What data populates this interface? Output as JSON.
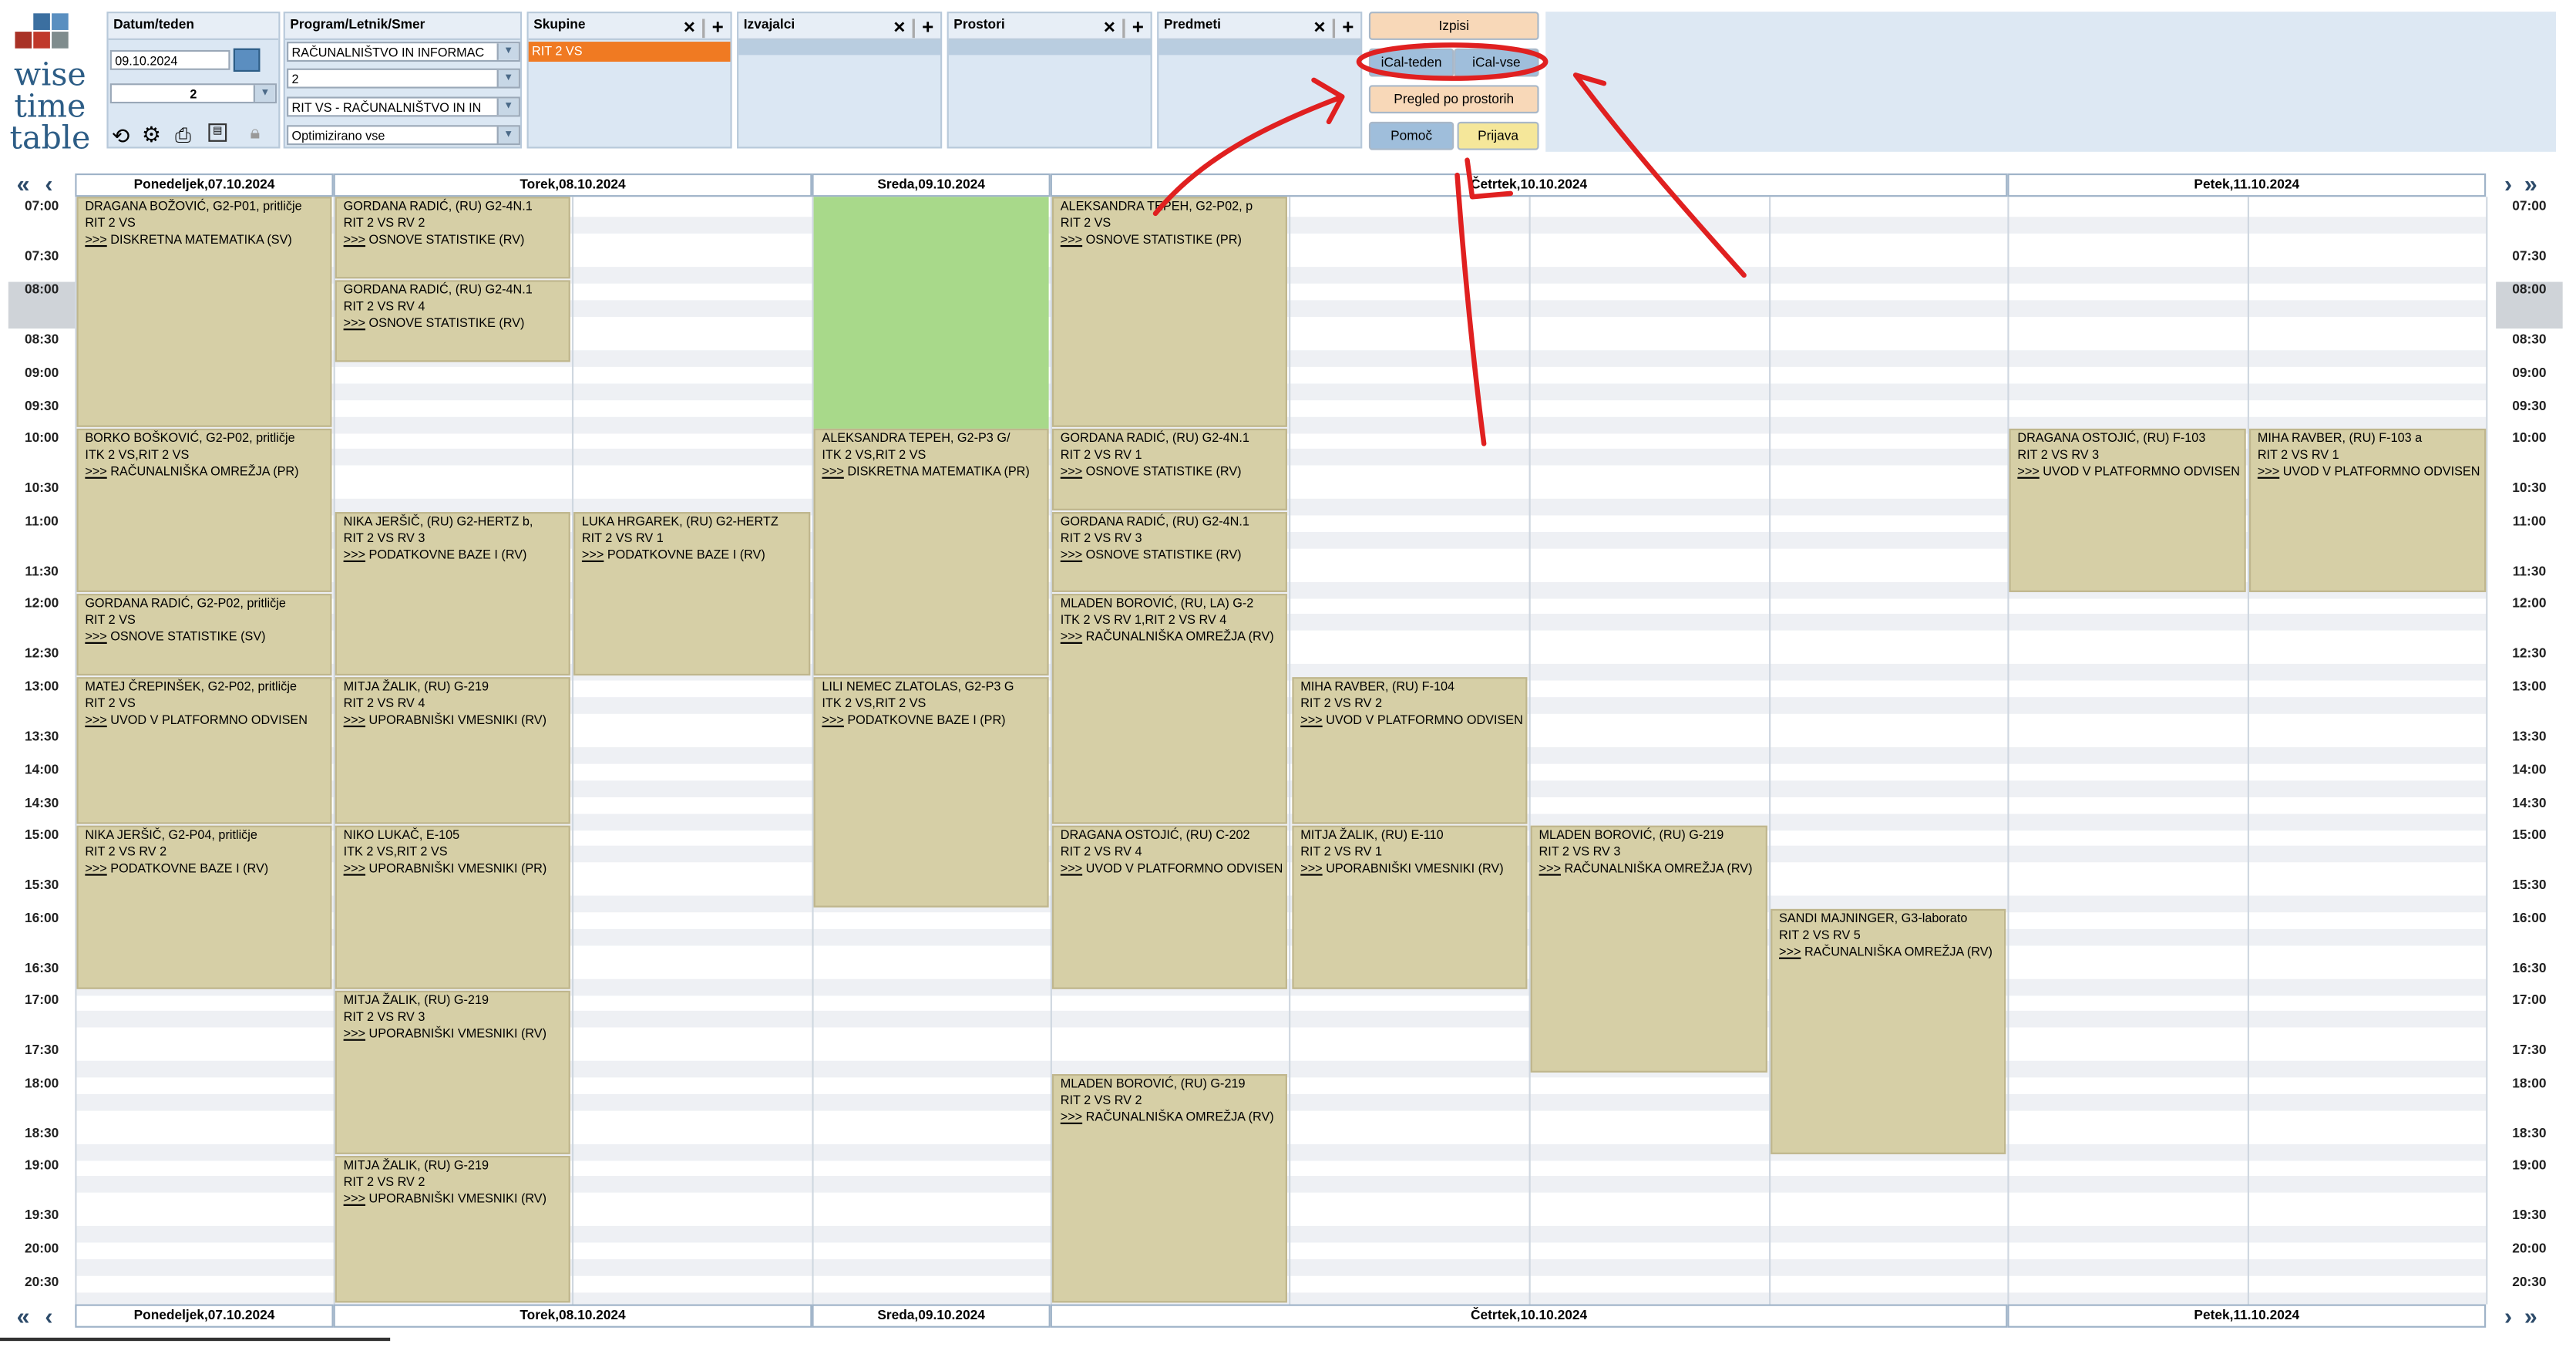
{
  "logo": {
    "line1": "wise",
    "line2": "time",
    "line3": "table"
  },
  "panels": {
    "datum": {
      "label": "Datum/teden",
      "date": "09.10.2024",
      "week": "2"
    },
    "program": {
      "label": "Program/Letnik/Smer",
      "program": "RAČUNALNIŠTVO IN INFORMAC",
      "letnik": "2",
      "smer": "RIT VS - RAČUNALNIŠTVO IN IN",
      "optim": "Optimizirano vse"
    },
    "skupine": {
      "label": "Skupine",
      "selected": "RIT 2 VS"
    },
    "izvajalci": {
      "label": "Izvajalci"
    },
    "prostori": {
      "label": "Prostori"
    },
    "predmeti": {
      "label": "Predmeti"
    }
  },
  "buttons": {
    "izpisi": "Izpisi",
    "ical_teden": "iCal-teden",
    "ical_vse": "iCal-vse",
    "pregled": "Pregled po prostorih",
    "pomoc": "Pomoč",
    "prijava": "Prijava"
  },
  "icons": {
    "close": "×",
    "add": "+",
    "first": "«",
    "prev": "‹",
    "next": "›",
    "last": "»"
  },
  "days": [
    "Ponedeljek,07.10.2024",
    "Torek,08.10.2024",
    "Sreda,09.10.2024",
    "Četrtek,10.10.2024",
    "Petek,11.10.2024"
  ],
  "times": [
    "07:00",
    "07:30",
    "08:00",
    "08:30",
    "09:00",
    "09:30",
    "10:00",
    "10:30",
    "11:00",
    "11:30",
    "12:00",
    "12:30",
    "13:00",
    "13:30",
    "14:00",
    "14:30",
    "15:00",
    "15:30",
    "16:00",
    "16:30",
    "17:00",
    "17:30",
    "18:00",
    "18:30",
    "19:00",
    "19:30",
    "20:00",
    "20:30"
  ],
  "events": [
    {
      "day": "Ponedeljek",
      "start": "07:00",
      "end": "10:00",
      "teacher": "DRAGANA BOŽOVIĆ, G2-P01, pritličje",
      "group": "RIT 2 VS",
      "subject": "DISKRETNA MATEMATIKA (SV)"
    },
    {
      "day": "Ponedeljek",
      "start": "10:00",
      "end": "12:00",
      "teacher": "BORKO BOŠKOVIĆ, G2-P02, pritličje",
      "group": "ITK 2  VS,RIT 2 VS",
      "subject": "RAČUNALNIŠKA OMREŽJA (PR)"
    },
    {
      "day": "Ponedeljek",
      "start": "12:00",
      "end": "13:00",
      "teacher": "GORDANA RADIĆ, G2-P02, pritličje",
      "group": "RIT 2 VS",
      "subject": "OSNOVE STATISTIKE (SV)"
    },
    {
      "day": "Ponedeljek",
      "start": "13:00",
      "end": "15:00",
      "teacher": "MATEJ ČREPINŠEK, G2-P02, pritličje",
      "group": "RIT 2 VS",
      "subject": "UVOD V PLATFORMNO ODVISEN"
    },
    {
      "day": "Ponedeljek",
      "start": "15:00",
      "end": "17:00",
      "teacher": "NIKA JERŠIČ, G2-P04, pritličje",
      "group": "RIT 2 VS RV 2",
      "subject": "PODATKOVNE BAZE I (RV)"
    },
    {
      "day": "Torek",
      "start": "07:00",
      "end": "08:00",
      "teacher": "GORDANA RADIĆ, (RU) G2-4N.1",
      "group": "RIT 2 VS RV 2",
      "subject": "OSNOVE STATISTIKE (RV)"
    },
    {
      "day": "Torek",
      "start": "08:00",
      "end": "09:00",
      "teacher": "GORDANA RADIĆ, (RU) G2-4N.1",
      "group": "RIT 2 VS RV 4",
      "subject": "OSNOVE STATISTIKE (RV)"
    },
    {
      "day": "Torek",
      "start": "11:00",
      "end": "13:00",
      "teacher": "NIKA JERŠIČ, (RU) G2-HERTZ b,",
      "group": "RIT 2 VS RV 3",
      "subject": "PODATKOVNE BAZE I (RV)"
    },
    {
      "day": "Torek",
      "start": "11:00",
      "end": "13:00",
      "teacher": "LUKA HRGAREK, (RU) G2-HERTZ",
      "group": "RIT 2 VS RV 1",
      "subject": "PODATKOVNE BAZE I (RV)"
    },
    {
      "day": "Torek",
      "start": "13:00",
      "end": "15:00",
      "teacher": "MITJA ŽALIK, (RU) G-219",
      "group": "RIT 2 VS RV 4",
      "subject": "UPORABNIŠKI VMESNIKI (RV)"
    },
    {
      "day": "Torek",
      "start": "15:00",
      "end": "17:00",
      "teacher": "NIKO LUKAČ, E-105",
      "group": "ITK 2  VS,RIT 2 VS",
      "subject": "UPORABNIŠKI VMESNIKI (PR)"
    },
    {
      "day": "Torek",
      "start": "17:00",
      "end": "19:00",
      "teacher": "MITJA ŽALIK, (RU) G-219",
      "group": "RIT 2 VS RV 3",
      "subject": "UPORABNIŠKI VMESNIKI (RV)"
    },
    {
      "day": "Torek",
      "start": "19:00",
      "end": "21:00",
      "teacher": "MITJA ŽALIK, (RU) G-219",
      "group": "RIT 2 VS RV 2",
      "subject": "UPORABNIŠKI VMESNIKI (RV)"
    },
    {
      "day": "Sreda",
      "start": "10:00",
      "end": "13:00",
      "teacher": "ALEKSANDRA TEPEH, G2-P3 G/",
      "group": "ITK 2  VS,RIT 2 VS",
      "subject": "DISKRETNA MATEMATIKA (PR)"
    },
    {
      "day": "Sreda",
      "start": "13:00",
      "end": "16:00",
      "teacher": "LILI NEMEC ZLATOLAS, G2-P3 G",
      "group": "ITK 2  VS,RIT 2 VS",
      "subject": "PODATKOVNE BAZE I (PR)"
    },
    {
      "day": "Četrtek",
      "start": "07:00",
      "end": "10:00",
      "teacher": "ALEKSANDRA TEPEH, G2-P02, p",
      "group": "RIT 2 VS",
      "subject": "OSNOVE STATISTIKE (PR)"
    },
    {
      "day": "Četrtek",
      "start": "10:00",
      "end": "11:00",
      "teacher": "GORDANA RADIĆ, (RU) G2-4N.1",
      "group": "RIT 2 VS RV 1",
      "subject": "OSNOVE STATISTIKE (RV)"
    },
    {
      "day": "Četrtek",
      "start": "11:00",
      "end": "12:00",
      "teacher": "GORDANA RADIĆ, (RU) G2-4N.1",
      "group": "RIT 2 VS RV 3",
      "subject": "OSNOVE STATISTIKE (RV)"
    },
    {
      "day": "Četrtek",
      "start": "12:00",
      "end": "15:00",
      "teacher": "MLADEN BOROVIĆ, (RU, LA) G-2",
      "group": "ITK 2 VS RV 1,RIT 2 VS RV 4",
      "subject": "RAČUNALNIŠKA OMREŽJA (RV)"
    },
    {
      "day": "Četrtek",
      "start": "15:00",
      "end": "17:00",
      "teacher": "DRAGANA OSTOJIĆ, (RU) C-202",
      "group": "RIT 2 VS RV 4",
      "subject": "UVOD V PLATFORMNO ODVISEN"
    },
    {
      "day": "Četrtek",
      "start": "18:00",
      "end": "21:00",
      "teacher": "MLADEN BOROVIĆ, (RU) G-219",
      "group": "RIT 2 VS RV 2",
      "subject": "RAČUNALNIŠKA OMREŽJA (RV)"
    },
    {
      "day": "Četrtek",
      "start": "13:00",
      "end": "15:00",
      "teacher": "MIHA RAVBER, (RU) F-104",
      "group": "RIT 2 VS RV 2",
      "subject": "UVOD V PLATFORMNO ODVISEN"
    },
    {
      "day": "Četrtek",
      "start": "15:00",
      "end": "17:00",
      "teacher": "MITJA ŽALIK, (RU) E-110",
      "group": "RIT 2 VS RV 1",
      "subject": "UPORABNIŠKI VMESNIKI (RV)"
    },
    {
      "day": "Četrtek",
      "start": "15:00",
      "end": "18:00",
      "teacher": "MLADEN BOROVIĆ, (RU) G-219",
      "group": "RIT 2 VS RV 3",
      "subject": "RAČUNALNIŠKA OMREŽJA (RV)"
    },
    {
      "day": "Četrtek",
      "start": "16:00",
      "end": "19:00",
      "teacher": "SANDI MAJNINGER, G3-laborato",
      "group": "RIT 2 VS RV 5",
      "subject": "RAČUNALNIŠKA OMREŽJA (RV)"
    },
    {
      "day": "Petek",
      "start": "10:00",
      "end": "12:00",
      "teacher": "DRAGANA OSTOJIĆ, (RU) F-103",
      "group": "RIT 2 VS RV 3",
      "subject": "UVOD V PLATFORMNO ODVISEN"
    },
    {
      "day": "Petek",
      "start": "10:00",
      "end": "12:00",
      "teacher": "MIHA RAVBER, (RU) F-103 a",
      "group": "RIT 2 VS RV 1",
      "subject": "UVOD V PLATFORMNO ODVISEN"
    }
  ],
  "arrow_marker": ">>>",
  "colors": {
    "event": "#d6cfa6",
    "today_free": "#a8d98a",
    "selected_group": "#f07a22",
    "annotation": "#e02020"
  }
}
